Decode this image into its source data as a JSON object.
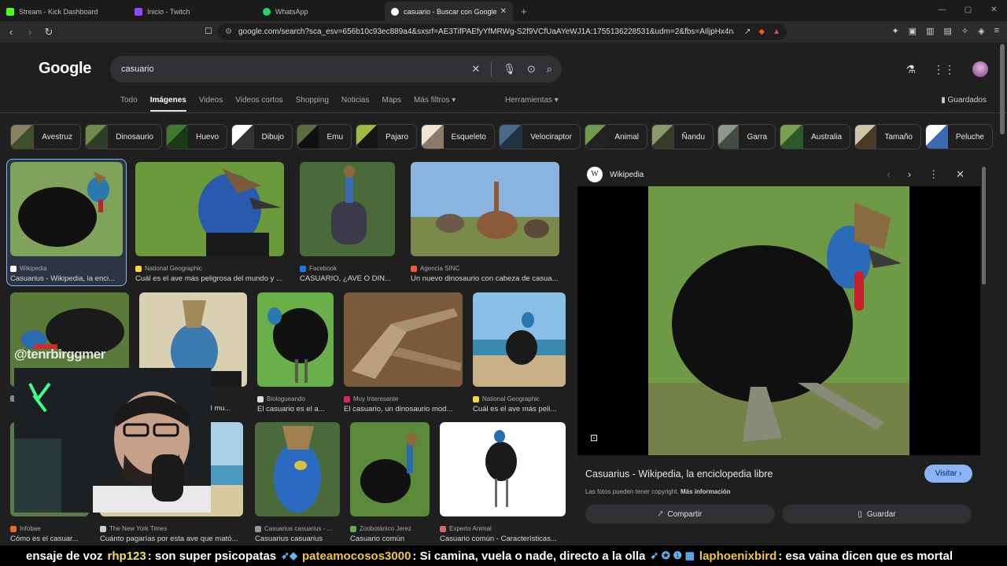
{
  "tabs": [
    {
      "label": "Stream - Kick Dashboard",
      "color": "#53fc18"
    },
    {
      "label": "Inicio - Twitch",
      "color": "#9146ff"
    },
    {
      "label": "WhatsApp",
      "color": "#25d366"
    },
    {
      "label": "casuario - Buscar con Google",
      "color": "#ffffff",
      "active": true
    }
  ],
  "url": "google.com/search?sca_esv=656b10c93ec889a4&sxsrf=AE3TifPAEfyYfMRWg-S2f9VCfUaAYeWJ1A:1755136228531&udm=2&fbs=AIljpHx4nJjfGojPVH...",
  "google": {
    "logo": "Google",
    "query": "casuario",
    "filters": [
      "Todo",
      "Imágenes",
      "Videos",
      "Videos cortos",
      "Shopping",
      "Noticias",
      "Maps",
      "Más filtros ▾"
    ],
    "selected_filter": "Imágenes",
    "tools": "Herramientas ▾",
    "saved": "Guardados"
  },
  "chips": [
    {
      "label": "Avestruz",
      "w": 90,
      "c1": "#8a8066",
      "c2": "#3f4f2a"
    },
    {
      "label": "Dinosaurio",
      "w": 98,
      "c1": "#6f8a4a",
      "c2": "#2e3f28"
    },
    {
      "label": "Huevo",
      "w": 78,
      "c1": "#3f7a30",
      "c2": "#1c3a16"
    },
    {
      "label": "Dibujo",
      "w": 78,
      "c1": "#ffffff",
      "c2": "#333333"
    },
    {
      "label": "Emu",
      "w": 70,
      "c1": "#5b6c3f",
      "c2": "#111111"
    },
    {
      "label": "Pajaro",
      "w": 78,
      "c1": "#a0b840",
      "c2": "#151515"
    },
    {
      "label": "Esqueleto",
      "w": 94,
      "c1": "#efe6d6",
      "c2": "#8a7a6a"
    },
    {
      "label": "Velociraptor",
      "w": 104,
      "c1": "#4a6a8a",
      "c2": "#223344"
    },
    {
      "label": "Animal",
      "w": 80,
      "c1": "#6f9a4a",
      "c2": "#222222"
    },
    {
      "label": "Ñandu",
      "w": 79,
      "c1": "#8a9a6a",
      "c2": "#3a3a2a"
    },
    {
      "label": "Garra",
      "w": 74,
      "c1": "#8a9a8a",
      "c2": "#444a44"
    },
    {
      "label": "Australia",
      "w": 90,
      "c1": "#7aa050",
      "c2": "#2a5a2a"
    },
    {
      "label": "Tamaño",
      "w": 85,
      "c1": "#cfc6a8",
      "c2": "#4a3a2a"
    },
    {
      "label": "Peluche",
      "w": 86,
      "c1": "#ffffff",
      "c2": "#3a6ab0"
    }
  ],
  "results": [
    {
      "source": "Wikipedia",
      "title": "Casuarius - Wikipedia, la enci...",
      "sc": "#ffffff"
    },
    {
      "source": "National Geographic",
      "title": "Cuál es el ave más peligrosa del mundo y ...",
      "sc": "#f5d742"
    },
    {
      "source": "Facebook",
      "title": "CASUARIO, ¿AVE O DIN...",
      "sc": "#1877f2"
    },
    {
      "source": "Agencia SINC",
      "title": "Un nuevo dinosaurio con cabeza de casua...",
      "sc": "#e85a3a"
    },
    {
      "source": "",
      "title": "",
      "sc": "#888888"
    },
    {
      "source": "",
      "title": "del mu...",
      "sc": "#888888"
    },
    {
      "source": "Biologueando",
      "title": "El casuario es el a...",
      "sc": "#dddddd"
    },
    {
      "source": "Muy Interesante",
      "title": "El casuario, un dinosaurio mod...",
      "sc": "#e0245e"
    },
    {
      "source": "National Geographic",
      "title": "Cuál es el ave más peli...",
      "sc": "#f5d742"
    },
    {
      "source": "Infobae",
      "title": "Cómo es el casuar...",
      "sc": "#e86a2a"
    },
    {
      "source": "The New York Times",
      "title": "Cuánto pagarías por esta ave que mató...",
      "sc": "#cccccc"
    },
    {
      "source": "Casuarius casuarius - ...",
      "title": "Casuarius casuarius",
      "sc": "#999999"
    },
    {
      "source": "Zoobotánico Jerez",
      "title": "Casuario común",
      "sc": "#6aa84f"
    },
    {
      "source": "Experto Animal",
      "title": "Casuario común - Características...",
      "sc": "#e06666"
    }
  ],
  "preview": {
    "site": "Wikipedia",
    "title": "Casuarius - Wikipedia, la enciclopedia libre",
    "visit": "Visitar",
    "copyright": "Las fotos pueden tener copyright.",
    "more_info": "Más información",
    "share": "Compartir",
    "save": "Guardar"
  },
  "stream": {
    "overlay_tag": "@tenrbirggmer",
    "chat": [
      {
        "text": "ensaje de voz"
      },
      {
        "user": "rhp123",
        "msg": ": son super psicopatas"
      },
      {
        "user": "pateamocosos3000",
        "msg": ": Si camina, vuela o nade, directo a la olla"
      },
      {
        "user": "laphoenixbird",
        "msg": ": esa vaina dicen que es mortal"
      }
    ]
  }
}
